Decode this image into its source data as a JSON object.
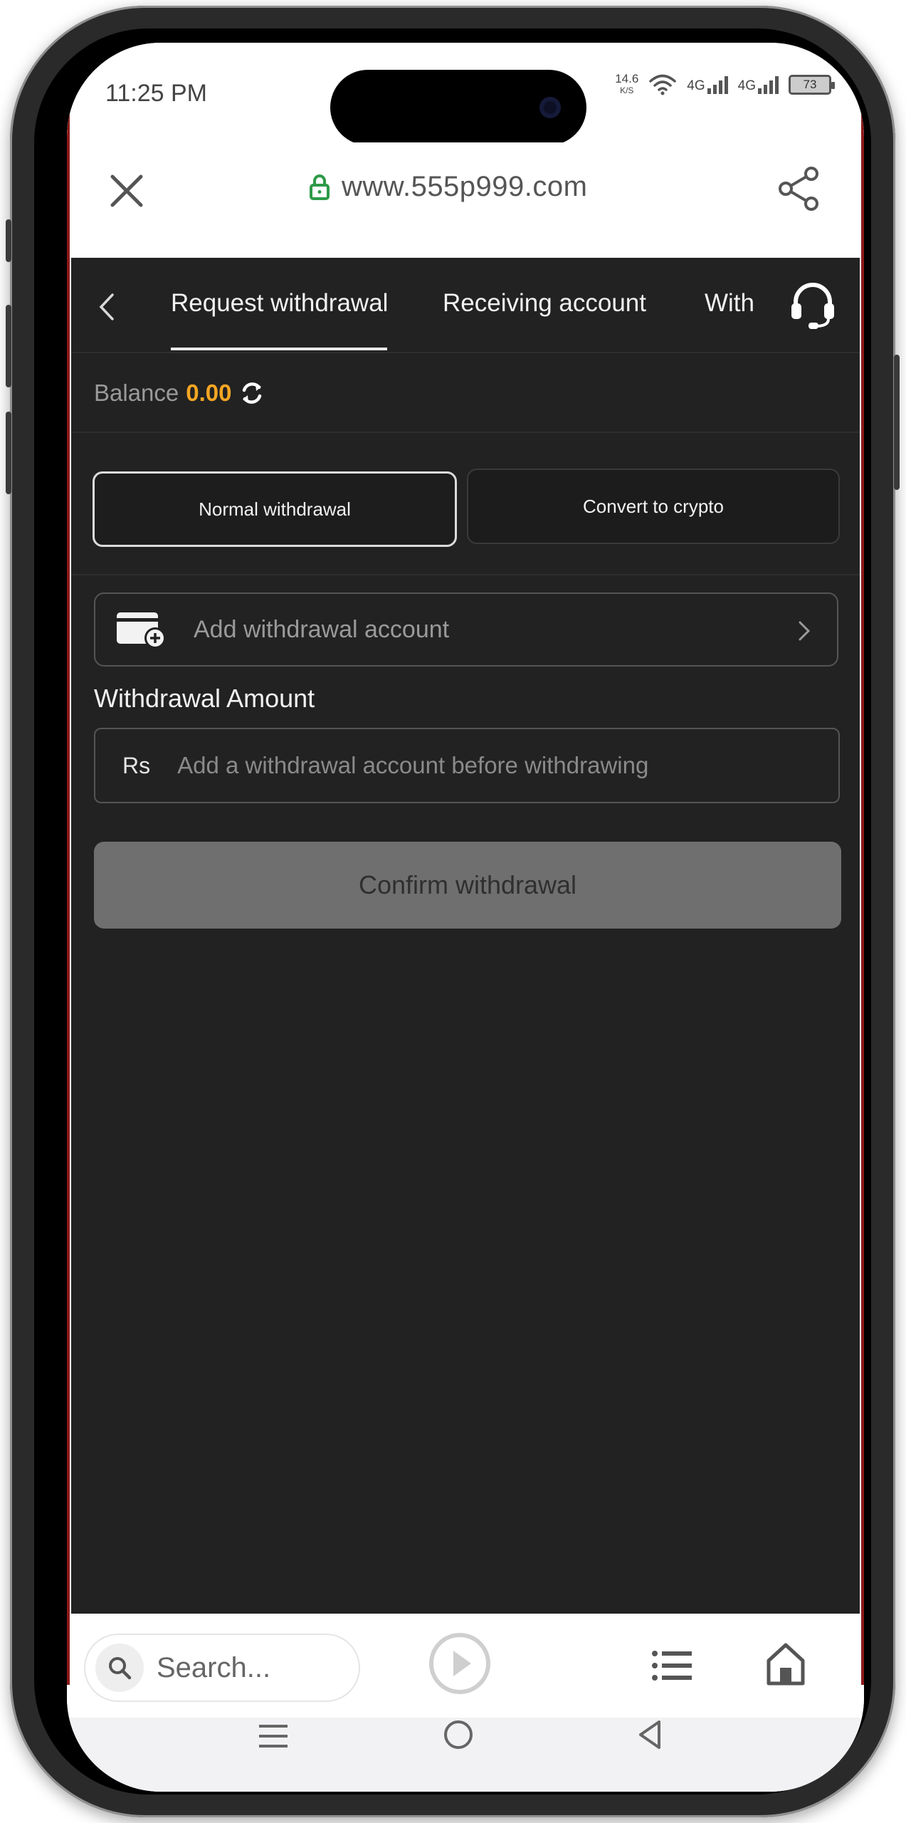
{
  "status_bar": {
    "time": "11:25 PM",
    "net_speed_value": "14.6",
    "net_speed_unit": "K/S",
    "signal1_label": "4G",
    "signal2_label": "4G",
    "battery": "73"
  },
  "browser": {
    "url": "www.555p999.com",
    "search_placeholder": "Search..."
  },
  "tabs": [
    {
      "label": "Request withdrawal",
      "active": true
    },
    {
      "label": "Receiving account",
      "active": false
    },
    {
      "label": "With",
      "active": false
    }
  ],
  "balance": {
    "label": "Balance",
    "value": "0.00"
  },
  "methods": {
    "normal": "Normal withdrawal",
    "crypto": "Convert to crypto"
  },
  "account": {
    "add_label": "Add withdrawal account"
  },
  "amount": {
    "label": "Withdrawal Amount",
    "currency": "Rs",
    "placeholder": "Add a withdrawal account before withdrawing"
  },
  "confirm": {
    "label": "Confirm withdrawal"
  },
  "colors": {
    "background": "#222222",
    "balance_accent": "#f5a623",
    "button_disabled": "#6f6f6f"
  }
}
